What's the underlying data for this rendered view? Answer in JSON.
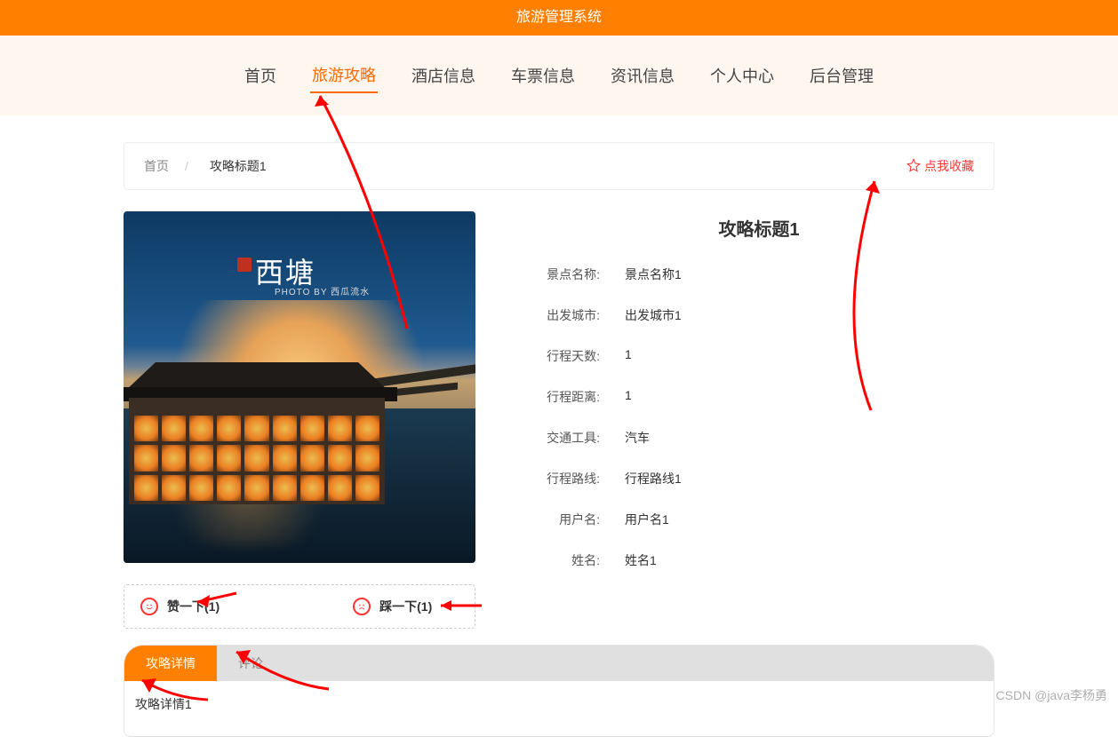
{
  "header": {
    "title": "旅游管理系统"
  },
  "nav": {
    "items": [
      {
        "label": "首页",
        "active": false
      },
      {
        "label": "旅游攻略",
        "active": true
      },
      {
        "label": "酒店信息",
        "active": false
      },
      {
        "label": "车票信息",
        "active": false
      },
      {
        "label": "资讯信息",
        "active": false
      },
      {
        "label": "个人中心",
        "active": false
      },
      {
        "label": "后台管理",
        "active": false
      }
    ]
  },
  "breadcrumb": {
    "home": "首页",
    "separator": "/",
    "current": "攻略标题1",
    "favorite_label": "点我收藏"
  },
  "photo": {
    "logo_text": "西塘",
    "photo_by": "PHOTO BY 西瓜流水"
  },
  "detail": {
    "title": "攻略标题1",
    "fields": [
      {
        "label": "景点名称:",
        "value": "景点名称1"
      },
      {
        "label": "出发城市:",
        "value": "出发城市1"
      },
      {
        "label": "行程天数:",
        "value": "1"
      },
      {
        "label": "行程距离:",
        "value": "1"
      },
      {
        "label": "交通工具:",
        "value": "汽车"
      },
      {
        "label": "行程路线:",
        "value": "行程路线1"
      },
      {
        "label": "用户名:",
        "value": "用户名1"
      },
      {
        "label": "姓名:",
        "value": "姓名1"
      }
    ]
  },
  "vote": {
    "like_label": "赞一下(1)",
    "dislike_label": "踩一下(1)"
  },
  "tabs": {
    "items": [
      {
        "label": "攻略详情",
        "active": true
      },
      {
        "label": "评论",
        "active": false
      }
    ],
    "content": "攻略详情1"
  },
  "watermark": "CSDN @java李杨勇"
}
